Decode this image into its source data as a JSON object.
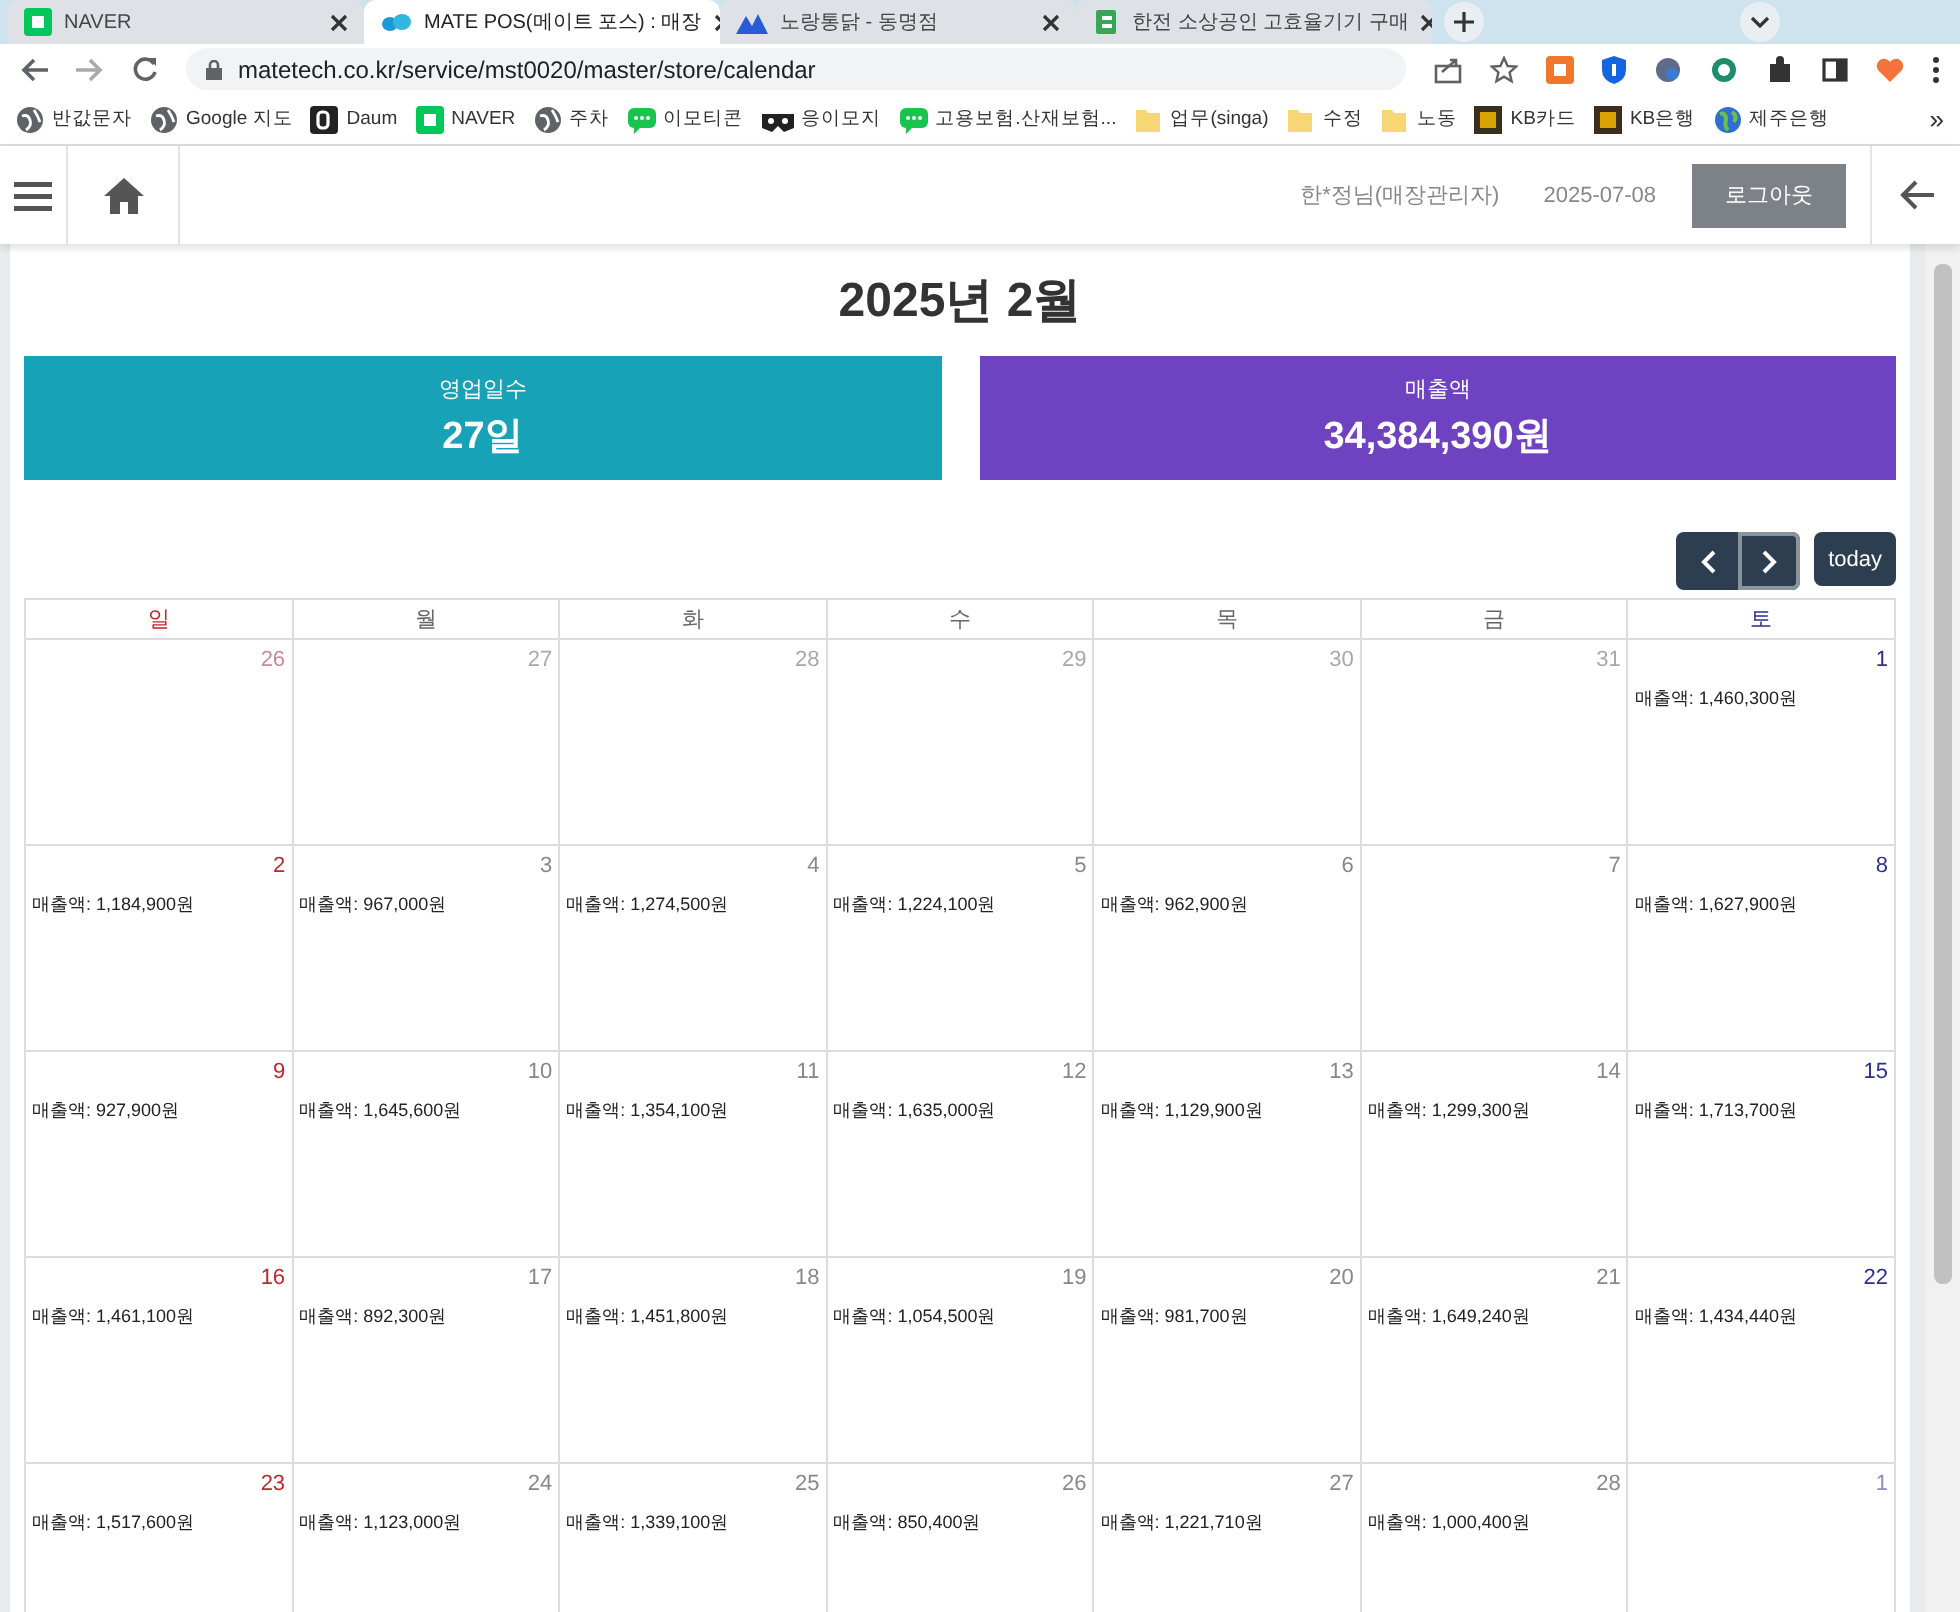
{
  "browser": {
    "tabs": [
      {
        "title": "NAVER",
        "selected": false
      },
      {
        "title": "MATE POS(메이트 포스) : 매장",
        "selected": true
      },
      {
        "title": "노랑통닭 - 동명점",
        "selected": false
      },
      {
        "title": "한전 소상공인 고효율기기 구매",
        "selected": false
      }
    ],
    "url": "matetech.co.kr/service/mst0020/master/store/calendar",
    "bookmarks": [
      "반값문자",
      "Google 지도",
      "Daum",
      "NAVER",
      "주차",
      "이모티콘",
      "응이모지",
      "고용보험.산재보험...",
      "업무(singa)",
      "수정",
      "노동",
      "KB카드",
      "KB은행",
      "제주은행"
    ],
    "more": "»"
  },
  "header": {
    "user": "한*정님(매장관리자)",
    "date": "2025-07-08",
    "logout": "로그아웃"
  },
  "title": "2025년 2월",
  "stats": [
    {
      "label": "영업일수",
      "value": "27일",
      "color": "#17a2b8"
    },
    {
      "label": "매출액",
      "value": "34,384,390원",
      "color": "#6f42c1"
    }
  ],
  "calendar": {
    "today": "today",
    "weekdays": [
      "일",
      "월",
      "화",
      "수",
      "목",
      "금",
      "토"
    ],
    "weeks": [
      [
        {
          "day": "26",
          "other_month": true
        },
        {
          "day": "27",
          "other_month": true
        },
        {
          "day": "28",
          "other_month": true
        },
        {
          "day": "29",
          "other_month": true
        },
        {
          "day": "30",
          "other_month": true
        },
        {
          "day": "31",
          "other_month": true
        },
        {
          "day": "1",
          "other_month": false,
          "sales": "매출액: 1,460,300원"
        }
      ],
      [
        {
          "day": "2",
          "other_month": false,
          "sales": "매출액: 1,184,900원"
        },
        {
          "day": "3",
          "other_month": false,
          "sales": "매출액: 967,000원"
        },
        {
          "day": "4",
          "other_month": false,
          "sales": "매출액: 1,274,500원"
        },
        {
          "day": "5",
          "other_month": false,
          "sales": "매출액: 1,224,100원"
        },
        {
          "day": "6",
          "other_month": false,
          "sales": "매출액: 962,900원"
        },
        {
          "day": "7",
          "other_month": false
        },
        {
          "day": "8",
          "other_month": false,
          "sales": "매출액: 1,627,900원"
        }
      ],
      [
        {
          "day": "9",
          "other_month": false,
          "sales": "매출액: 927,900원"
        },
        {
          "day": "10",
          "other_month": false,
          "sales": "매출액: 1,645,600원"
        },
        {
          "day": "11",
          "other_month": false,
          "sales": "매출액: 1,354,100원"
        },
        {
          "day": "12",
          "other_month": false,
          "sales": "매출액: 1,635,000원"
        },
        {
          "day": "13",
          "other_month": false,
          "sales": "매출액: 1,129,900원"
        },
        {
          "day": "14",
          "other_month": false,
          "sales": "매출액: 1,299,300원"
        },
        {
          "day": "15",
          "other_month": false,
          "sales": "매출액: 1,713,700원"
        }
      ],
      [
        {
          "day": "16",
          "other_month": false,
          "sales": "매출액: 1,461,100원"
        },
        {
          "day": "17",
          "other_month": false,
          "sales": "매출액: 892,300원"
        },
        {
          "day": "18",
          "other_month": false,
          "sales": "매출액: 1,451,800원"
        },
        {
          "day": "19",
          "other_month": false,
          "sales": "매출액: 1,054,500원"
        },
        {
          "day": "20",
          "other_month": false,
          "sales": "매출액: 981,700원"
        },
        {
          "day": "21",
          "other_month": false,
          "sales": "매출액: 1,649,240원"
        },
        {
          "day": "22",
          "other_month": false,
          "sales": "매출액: 1,434,440원"
        }
      ],
      [
        {
          "day": "23",
          "other_month": false,
          "sales": "매출액: 1,517,600원"
        },
        {
          "day": "24",
          "other_month": false,
          "sales": "매출액: 1,123,000원"
        },
        {
          "day": "25",
          "other_month": false,
          "sales": "매출액: 1,339,100원"
        },
        {
          "day": "26",
          "other_month": false,
          "sales": "매출액: 850,400원"
        },
        {
          "day": "27",
          "other_month": false,
          "sales": "매출액: 1,221,710원"
        },
        {
          "day": "28",
          "other_month": false,
          "sales": "매출액: 1,000,400원"
        },
        {
          "day": "1",
          "other_month": true
        }
      ]
    ]
  }
}
